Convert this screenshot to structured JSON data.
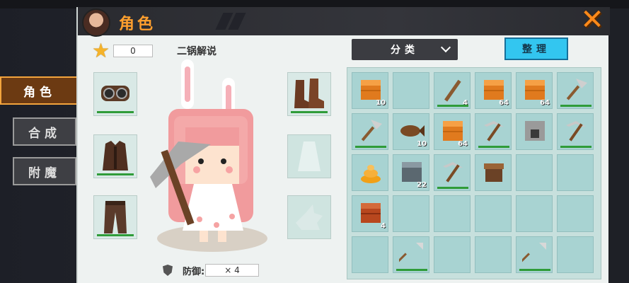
{
  "title": "角色",
  "side_tabs": [
    {
      "label": "角色",
      "active": true
    },
    {
      "label": "合成",
      "active": false
    },
    {
      "label": "附魔",
      "active": false
    }
  ],
  "stars": "0",
  "character_name": "二锅解说",
  "defense": {
    "label": "防御:",
    "value": "× 4"
  },
  "dropdown": {
    "label": "分类"
  },
  "sort_button": "整理",
  "equipment_left": [
    {
      "item": "goggles-icon"
    },
    {
      "item": "leather-vest-icon"
    },
    {
      "item": "leather-pants-icon"
    }
  ],
  "equipment_right": [
    {
      "item": "leather-boots-icon"
    },
    {
      "item": "cape-placeholder-icon"
    },
    {
      "item": "pet-placeholder-icon"
    }
  ],
  "inventory": [
    {
      "item": "wood-block-icon",
      "count": "10"
    },
    {
      "item": "",
      "count": ""
    },
    {
      "item": "wood-stick-icon",
      "count": "4"
    },
    {
      "item": "wood-block-icon",
      "count": "64"
    },
    {
      "item": "wood-block-icon",
      "count": "64"
    },
    {
      "item": "shovel-icon",
      "count": ""
    },
    {
      "item": "shovel-icon",
      "count": ""
    },
    {
      "item": "fish-icon",
      "count": "10"
    },
    {
      "item": "wood-block-icon",
      "count": "64"
    },
    {
      "item": "pickaxe-icon",
      "count": ""
    },
    {
      "item": "furnace-icon",
      "count": ""
    },
    {
      "item": "pickaxe-icon",
      "count": ""
    },
    {
      "item": "dung-icon",
      "count": ""
    },
    {
      "item": "stone-block-icon",
      "count": "22"
    },
    {
      "item": "pickaxe-icon",
      "count": ""
    },
    {
      "item": "crafting-table-icon",
      "count": ""
    },
    {
      "item": "",
      "count": ""
    },
    {
      "item": "",
      "count": ""
    },
    {
      "item": "red-wood-block-icon",
      "count": "4"
    },
    {
      "item": "",
      "count": ""
    },
    {
      "item": "",
      "count": ""
    },
    {
      "item": "",
      "count": ""
    },
    {
      "item": "",
      "count": ""
    },
    {
      "item": "",
      "count": ""
    },
    {
      "item": "",
      "count": ""
    },
    {
      "item": "spear-icon",
      "count": ""
    },
    {
      "item": "",
      "count": ""
    },
    {
      "item": "",
      "count": ""
    },
    {
      "item": "spear-icon",
      "count": ""
    },
    {
      "item": "",
      "count": ""
    }
  ],
  "colors": {
    "accent": "#ff9f2e",
    "sort_button": "#33c6f0",
    "slot": "#a8d3d2"
  }
}
